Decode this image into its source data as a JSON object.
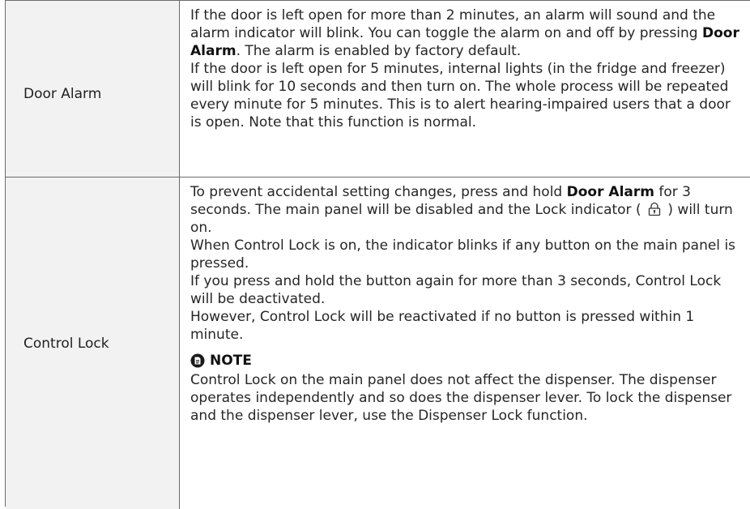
{
  "rows": [
    {
      "label": "Door Alarm",
      "paragraphs": [
        {
          "pre": "If the door is left open for more than 2 minutes, an alarm will sound and the alarm indicator will blink. You can toggle the alarm on and off by pressing ",
          "bold": "Door Alarm",
          "post": ". The alarm is enabled by factory default."
        },
        {
          "text": "If the door is left open for 5 minutes, internal lights (in the fridge and freezer) will blink for 10 seconds and then turn on. The whole process will be repeated every minute for 5 minutes. This is to alert hearing-impaired users that a door is open. Note that this function is normal."
        }
      ]
    },
    {
      "label": "Control Lock",
      "paragraphs": [
        {
          "pre": "To prevent accidental setting changes, press and hold ",
          "bold": "Door Alarm",
          "mid": " for 3 seconds. The main panel will be disabled and the Lock indicator ( ",
          "post": " ) will turn on."
        },
        {
          "text": "When Control Lock is on, the indicator blinks if any button on the main panel is pressed."
        },
        {
          "text": "If you press and hold the button again for more than 3 seconds, Control Lock will be deactivated."
        },
        {
          "text": "However, Control Lock will be reactivated if no button is pressed within 1 minute."
        }
      ],
      "note": {
        "icon": "note-icon",
        "heading": "NOTE",
        "text": "Control Lock on the main panel does not affect the dispenser. The dispenser operates independently and so does the dispenser lever. To lock the dispenser and the dispenser lever, use the Dispenser Lock function."
      }
    }
  ],
  "icons": {
    "lock_indicator": "lock-icon"
  },
  "colors": {
    "label_background": "#f2f2f2",
    "border": "#6b6b6b"
  }
}
